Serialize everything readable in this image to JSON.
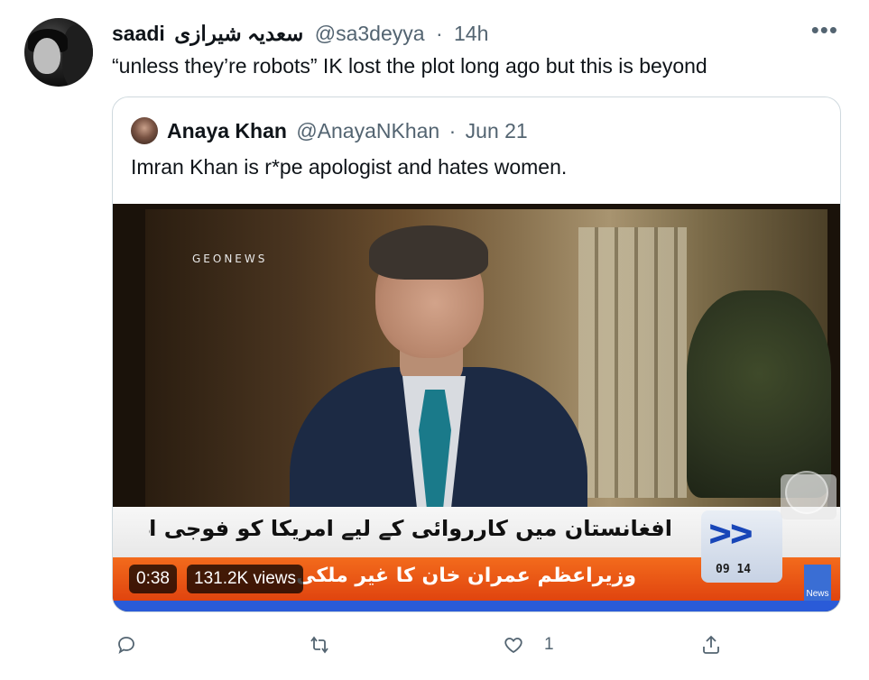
{
  "tweet": {
    "author_name": "saadi",
    "author_name_urdu": "سعدیہ شیرازی",
    "handle": "@sa3deyya",
    "separator": "·",
    "time": "14h",
    "more_icon": "more-horizontal-icon",
    "text": "“unless they’re robots” IK lost the plot long ago but this is beyond"
  },
  "quoted_tweet": {
    "author_name": "Anaya Khan",
    "handle": "@AnayaNKhan",
    "separator": "·",
    "date": "Jun 21",
    "text": "Imran Khan is r*pe apologist and hates women.",
    "video": {
      "watermark": "GEONEWS",
      "ticker_line_1": "افغانستان میں کارروائی کے لیے امریکا کو فوجی اڈے دینے سے انکار",
      "ticker_line_2": "وزیراعظم عمران خان کا غیر ملکی ٹی وی کو",
      "logo_time": "09 14",
      "logo_badge": "News",
      "duration": "0:38",
      "views": "131.2K views"
    }
  },
  "actions": {
    "reply_icon": "reply-icon",
    "retweet_icon": "retweet-icon",
    "like_icon": "heart-icon",
    "like_count": "1",
    "share_icon": "share-icon"
  },
  "colors": {
    "text_primary": "#0f1419",
    "text_secondary": "#536471",
    "border": "#cfd9de",
    "ticker_orange": "#e0440f"
  }
}
